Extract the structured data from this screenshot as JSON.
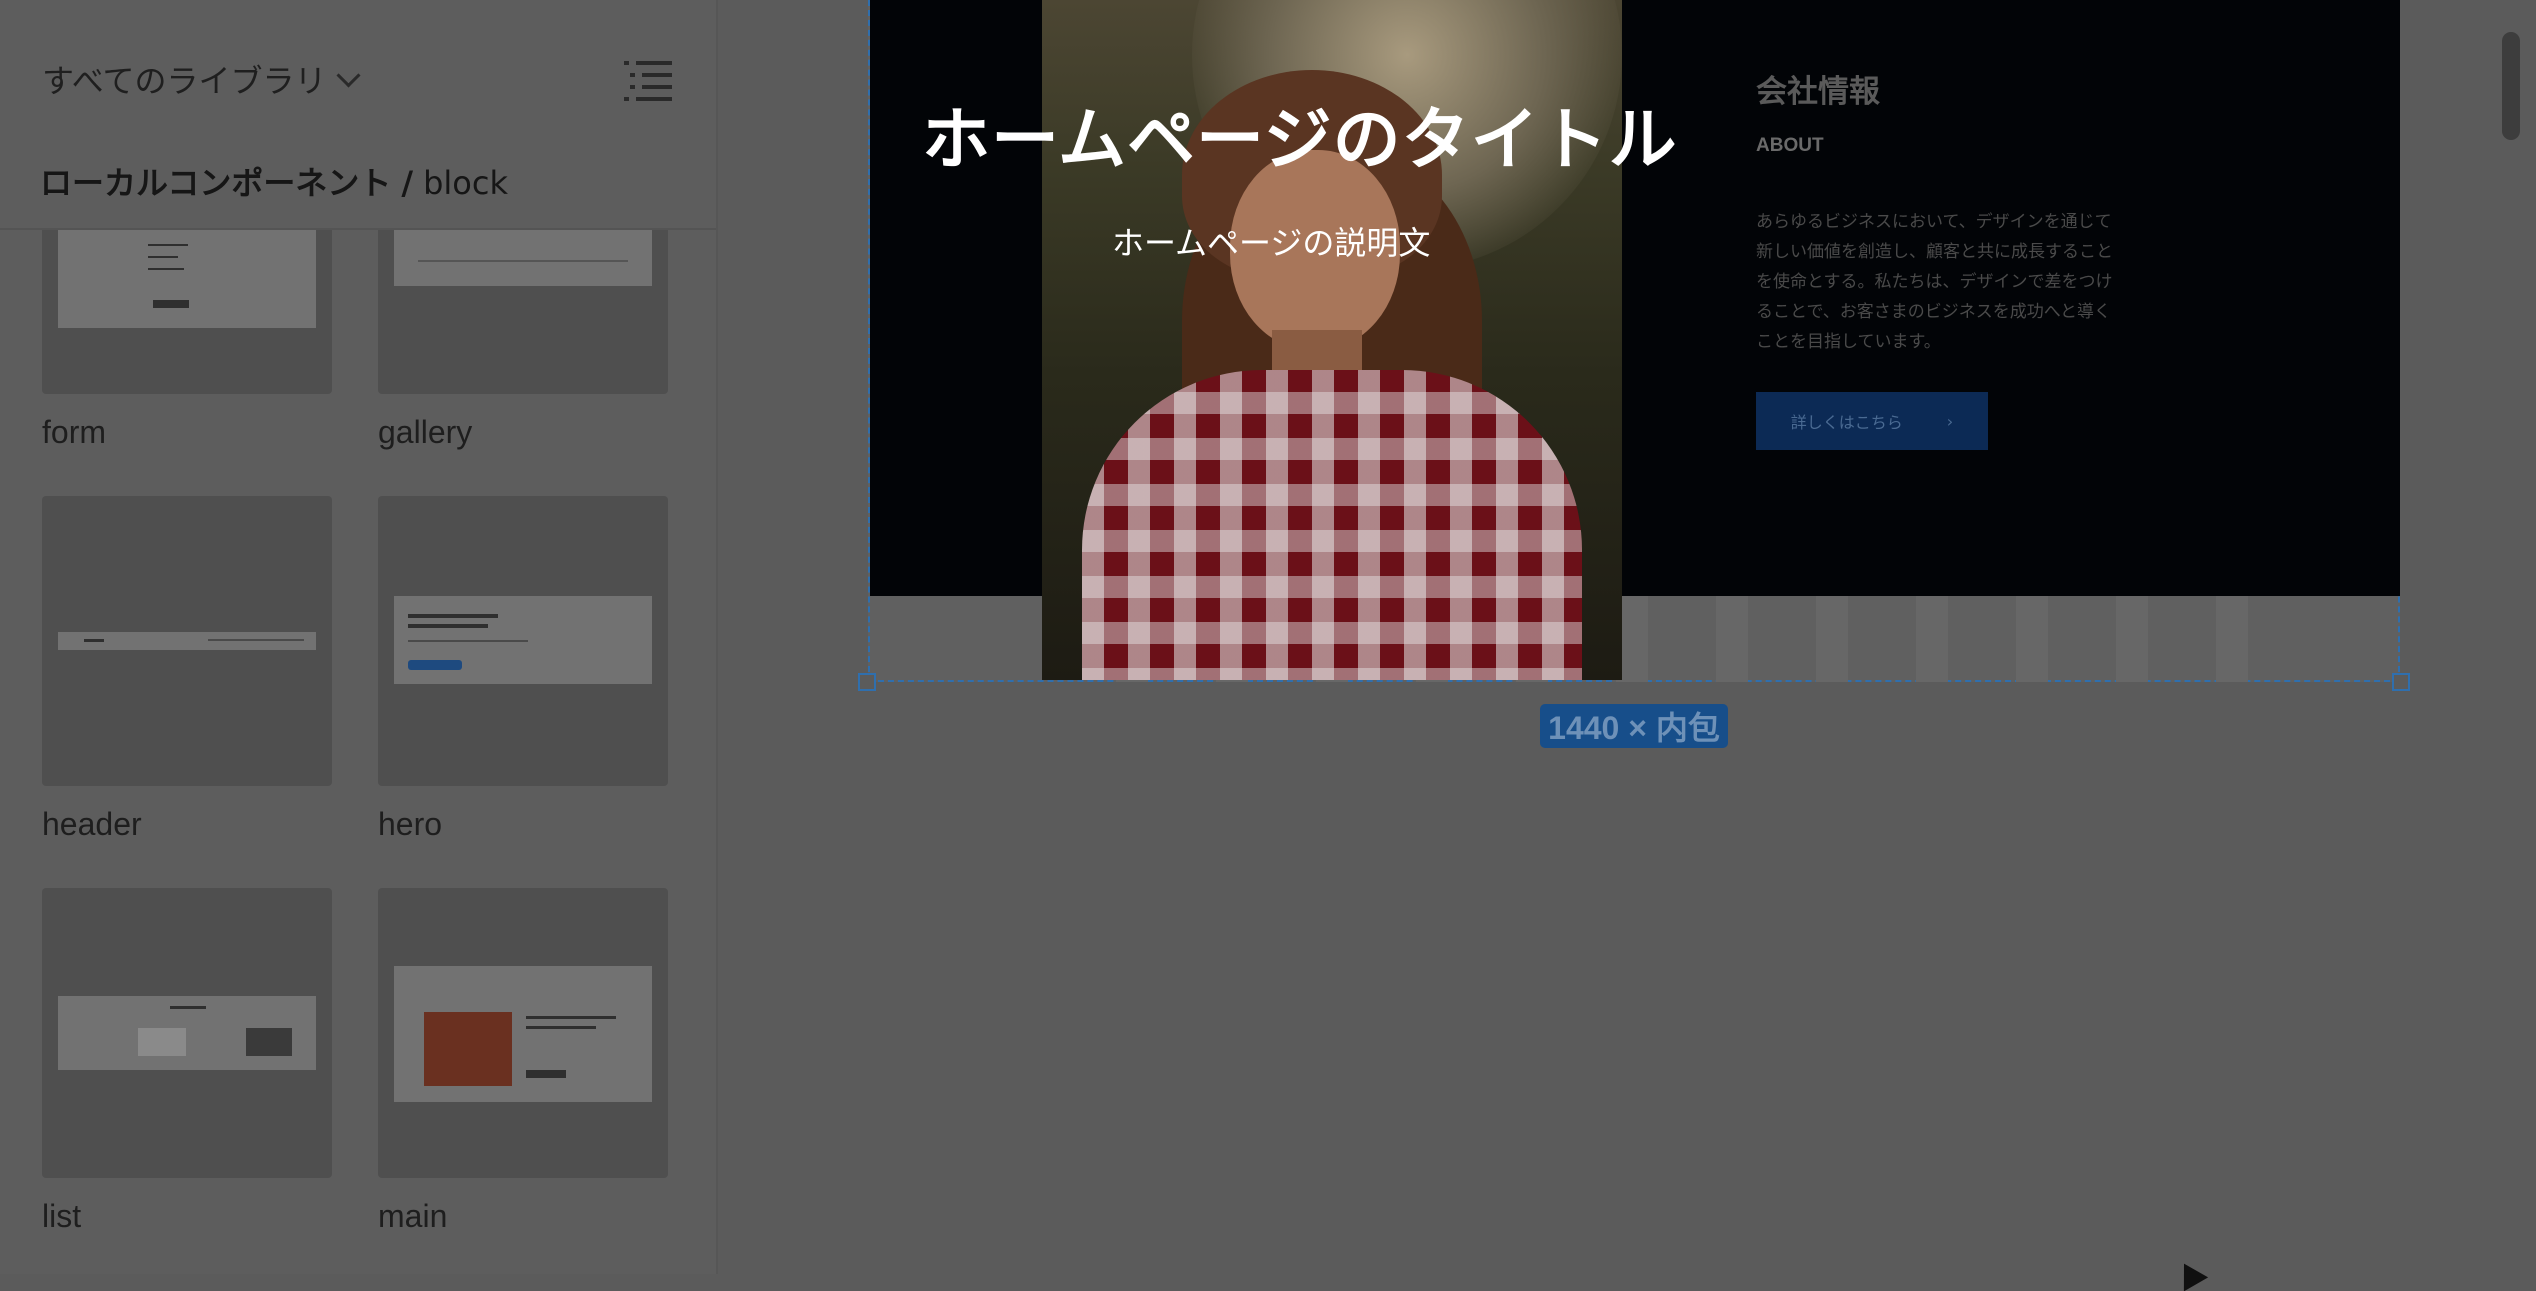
{
  "assets_panel": {
    "library_selector": "すべてのライブラリ",
    "breadcrumb": {
      "root": "ローカルコンポーネント",
      "separator": "/",
      "leaf": "block"
    },
    "components": [
      {
        "label": "form"
      },
      {
        "label": "gallery"
      },
      {
        "label": "header"
      },
      {
        "label": "hero"
      },
      {
        "label": "list"
      },
      {
        "label": "main"
      }
    ]
  },
  "canvas": {
    "hero": {
      "title": "ホームページのタイトル",
      "description": "ホームページの説明文"
    },
    "about": {
      "heading": "会社情報",
      "subheading": "ABOUT",
      "body": "あらゆるビジネスにおいて、デザインを通じて新しい価値を創造し、顧客と共に成長することを使命とする。私たちは、デザインで差をつけることで、お客さまのビジネスを成功へと導くことを目指しています。",
      "button_label": "詳しくはこちら",
      "button_arrow": "›"
    },
    "size_badge": "1440 × 内包"
  },
  "icons": [
    "chevron-down-icon",
    "list-view-icon",
    "cursor-icon"
  ],
  "colors": {
    "selection": "#2f6fae",
    "badge": "#174e8a"
  }
}
